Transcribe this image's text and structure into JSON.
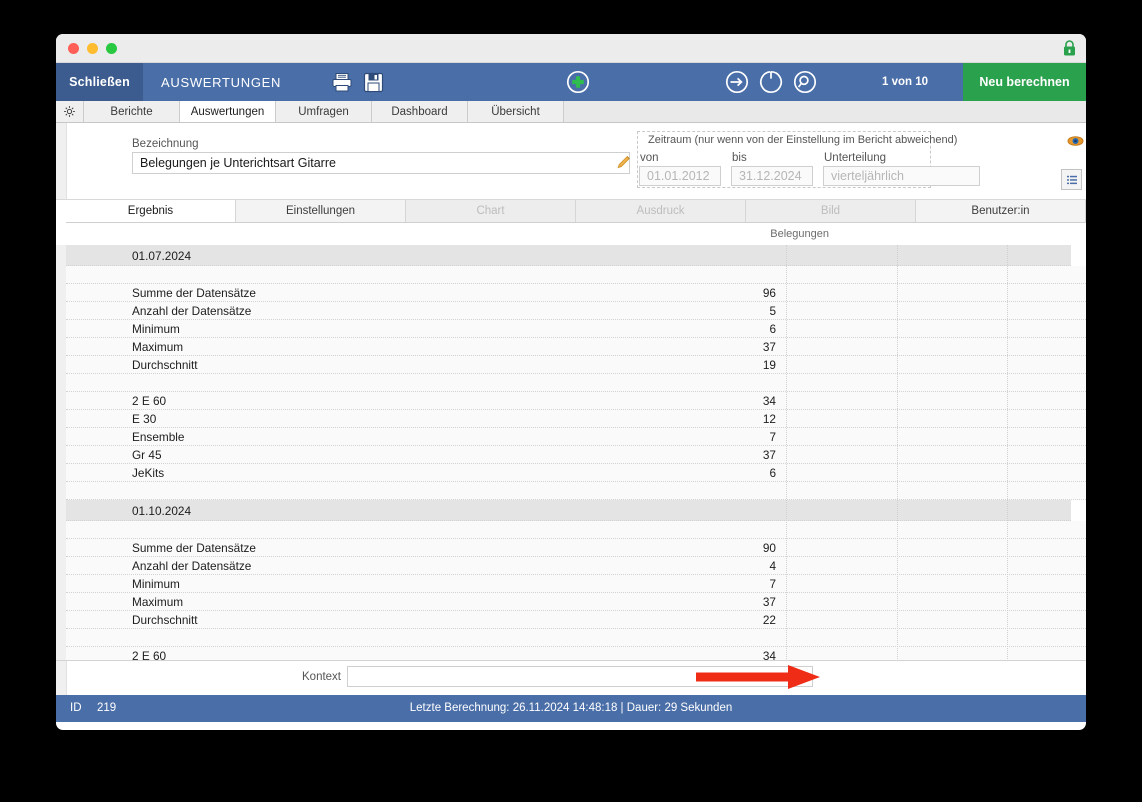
{
  "window": {
    "lock_icon": "lock-icon",
    "traffic_lights": [
      "close",
      "minimize",
      "maximize"
    ]
  },
  "toolbar": {
    "close_label": "Schließen",
    "title": "AUSWERTUNGEN",
    "icons": [
      "printer-icon",
      "save-icon",
      "add-circle-icon",
      "arrow-right-circle-icon",
      "refresh-circle-icon",
      "search-circle-icon"
    ],
    "record_counter": "1 von 10",
    "recalculate_label": "Neu berechnen",
    "accent_blue": "#4a6ea8",
    "close_blue": "#3c5c90",
    "green": "#2aa14c"
  },
  "module_tabs": {
    "gear_icon": "gear-icon",
    "items": [
      {
        "label": "Berichte",
        "active": false
      },
      {
        "label": "Auswertungen",
        "active": true
      },
      {
        "label": "Umfragen",
        "active": false
      },
      {
        "label": "Dashboard",
        "active": false
      },
      {
        "label": "Übersicht",
        "active": false
      }
    ]
  },
  "form": {
    "bezeichnung_label": "Bezeichnung",
    "bezeichnung_value": "Belegungen je Unterichtsart Gitarre",
    "pencil_icon": "pencil-icon",
    "eye_icon": "eye-icon",
    "list_icon": "list-icon",
    "zeitraum": {
      "legend": "Zeitraum (nur wenn von der Einstellung im Bericht abweichend)",
      "von_label": "von",
      "von_value": "01.01.2012",
      "bis_label": "bis",
      "bis_value": "31.12.2024",
      "unterteilung_label": "Unterteilung",
      "unterteilung_value": "vierteljährlich",
      "calendar_icon": "calendar-icon",
      "chevron_icon": "chevron-down-icon"
    }
  },
  "result_tabs": [
    {
      "label": "Ergebnis",
      "state": "active"
    },
    {
      "label": "Einstellungen",
      "state": "enabled"
    },
    {
      "label": "Chart",
      "state": "disabled"
    },
    {
      "label": "Ausdruck",
      "state": "disabled"
    },
    {
      "label": "Bild",
      "state": "disabled"
    },
    {
      "label": "Benutzer:in",
      "state": "enabled"
    }
  ],
  "table": {
    "column_header": "Belegungen",
    "rows": [
      {
        "type": "group",
        "label": "01.07.2024",
        "value": ""
      },
      {
        "type": "blank",
        "label": "",
        "value": ""
      },
      {
        "type": "data",
        "label": "Summe der Datensätze",
        "value": "96"
      },
      {
        "type": "data",
        "label": "Anzahl der Datensätze",
        "value": "5"
      },
      {
        "type": "data",
        "label": "Minimum",
        "value": "6"
      },
      {
        "type": "data",
        "label": "Maximum",
        "value": "37"
      },
      {
        "type": "data",
        "label": "Durchschnitt",
        "value": "19"
      },
      {
        "type": "blank",
        "label": "",
        "value": ""
      },
      {
        "type": "data",
        "label": "2 E 60",
        "value": "34"
      },
      {
        "type": "data",
        "label": "E 30",
        "value": "12"
      },
      {
        "type": "data",
        "label": "Ensemble",
        "value": "7"
      },
      {
        "type": "data",
        "label": "Gr 45",
        "value": "37"
      },
      {
        "type": "data",
        "label": "JeKits",
        "value": "6"
      },
      {
        "type": "blank",
        "label": "",
        "value": ""
      },
      {
        "type": "group",
        "label": "01.10.2024",
        "value": ""
      },
      {
        "type": "blank",
        "label": "",
        "value": ""
      },
      {
        "type": "data",
        "label": "Summe der Datensätze",
        "value": "90"
      },
      {
        "type": "data",
        "label": "Anzahl der Datensätze",
        "value": "4"
      },
      {
        "type": "data",
        "label": "Minimum",
        "value": "7"
      },
      {
        "type": "data",
        "label": "Maximum",
        "value": "37"
      },
      {
        "type": "data",
        "label": "Durchschnitt",
        "value": "22"
      },
      {
        "type": "blank",
        "label": "",
        "value": ""
      },
      {
        "type": "data",
        "label": "2 E 60",
        "value": "34"
      }
    ]
  },
  "kontext": {
    "label": "Kontext",
    "value": "",
    "chevron_icon": "chevron-down-icon",
    "annotation_arrow_color": "#ef2d16"
  },
  "statusbar": {
    "id_label": "ID",
    "id_value": "219",
    "center_text": "Letzte Berechnung: 26.11.2024 14:48:18  |  Dauer: 29 Sekunden"
  }
}
